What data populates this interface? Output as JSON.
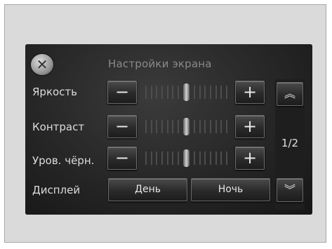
{
  "title": "Настройки экрана",
  "close": {
    "symbol": "✕"
  },
  "rows": [
    {
      "label": "Яркость",
      "minus": "−",
      "plus": "+",
      "level": 0.5
    },
    {
      "label": "Контраст",
      "minus": "−",
      "plus": "+",
      "level": 0.5
    },
    {
      "label": "Уров. чёрн.",
      "minus": "−",
      "plus": "+",
      "level": 0.5
    }
  ],
  "display": {
    "label": "Дисплей",
    "day": "День",
    "night": "Ночь"
  },
  "pager": {
    "indicator": "1/2",
    "up": "︽",
    "down": "︾"
  }
}
